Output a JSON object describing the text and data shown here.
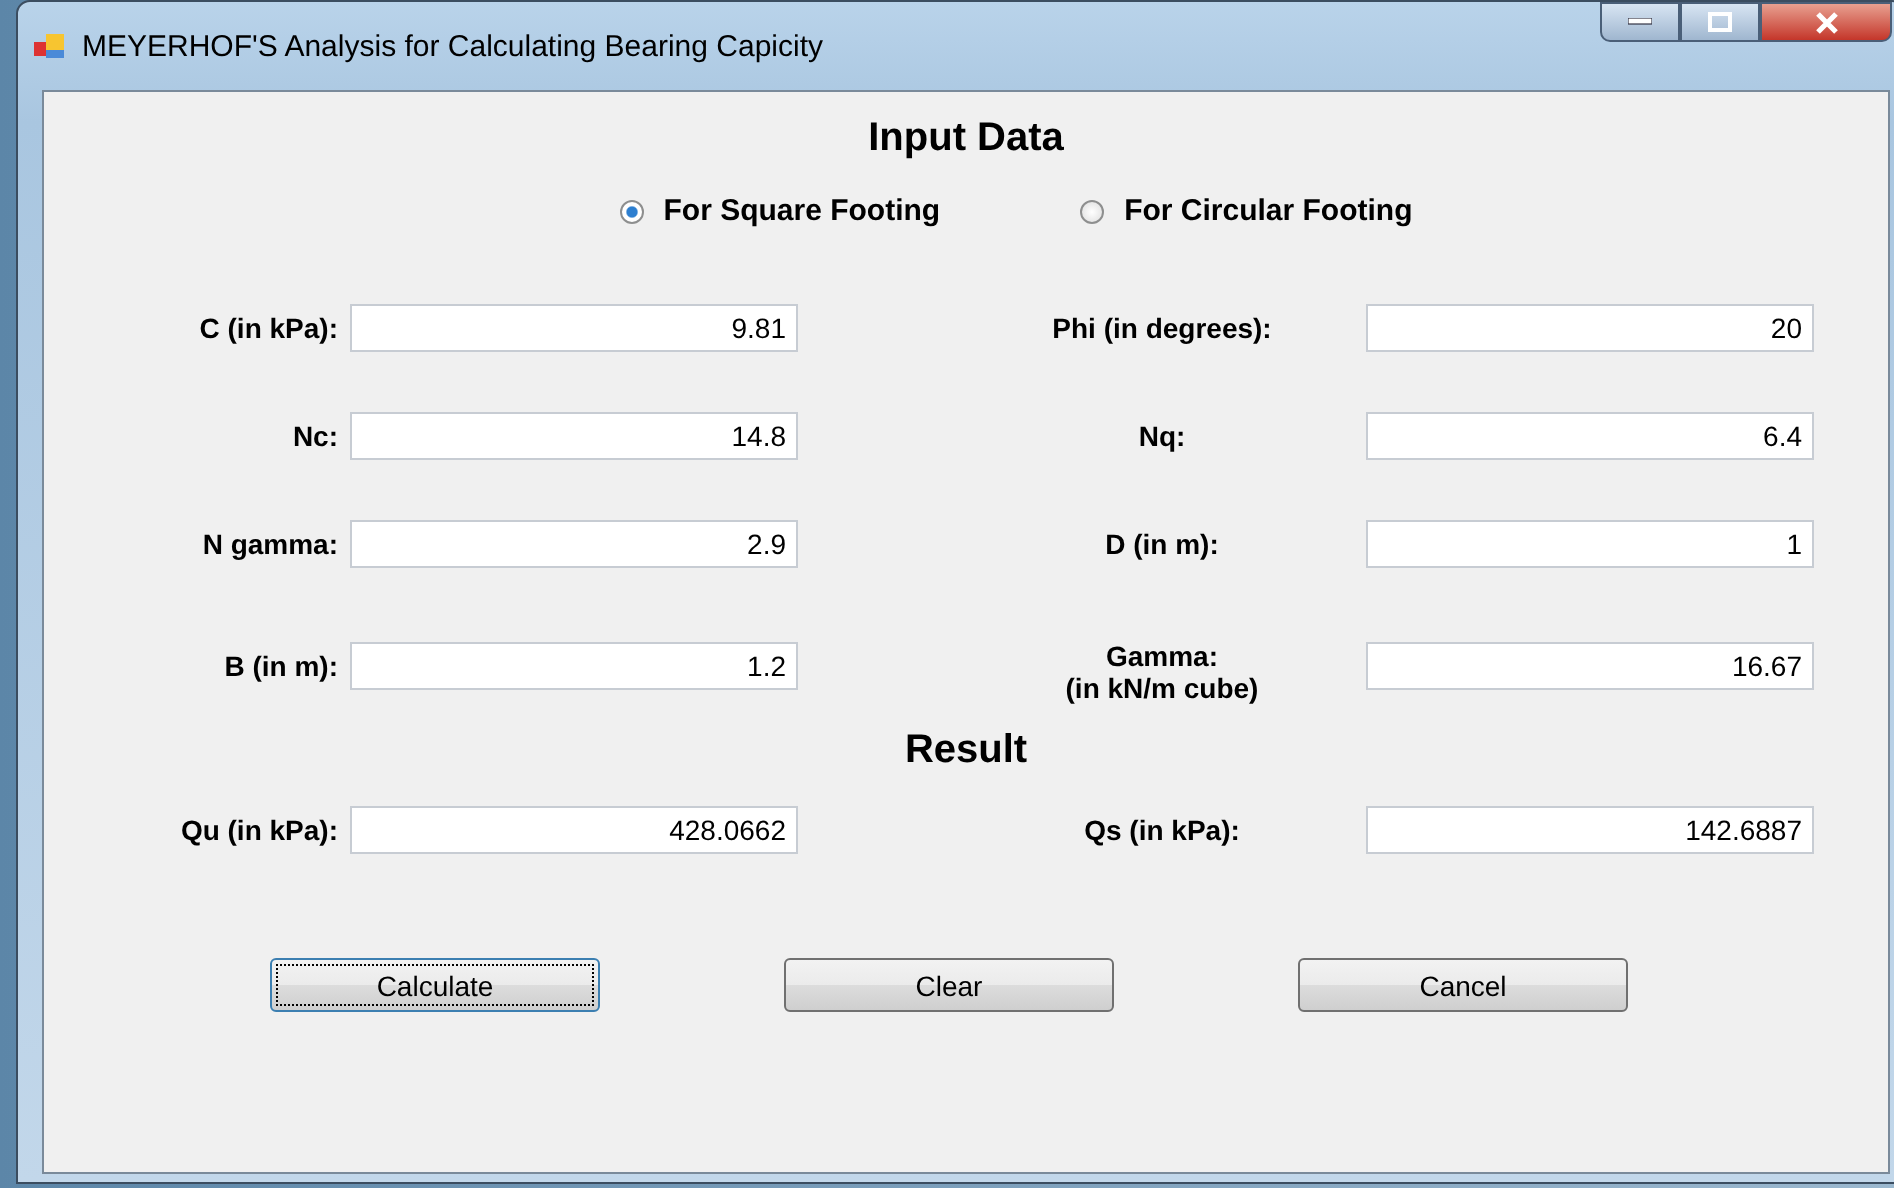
{
  "window": {
    "title": "MEYERHOF'S Analysis for Calculating Bearing Capicity"
  },
  "input_heading": "Input Data",
  "footing_options": [
    {
      "label": "For Square Footing",
      "selected": true
    },
    {
      "label": "For Circular Footing",
      "selected": false
    }
  ],
  "inputs": [
    {
      "label": "C (in kPa):",
      "value": "9.81"
    },
    {
      "label": "Phi (in degrees):",
      "value": "20"
    },
    {
      "label": "Nc:",
      "value": "14.8"
    },
    {
      "label": "Nq:",
      "value": "6.4"
    },
    {
      "label": "N gamma:",
      "value": "2.9"
    },
    {
      "label": "D (in m):",
      "value": "1"
    },
    {
      "label": "B (in m):",
      "value": "1.2"
    },
    {
      "label": "Gamma:\n(in kN/m cube)",
      "value": "16.67"
    }
  ],
  "result_heading": "Result",
  "results": [
    {
      "label": "Qu (in kPa):",
      "value": "428.0662"
    },
    {
      "label": "Qs (in kPa):",
      "value": "142.6887"
    }
  ],
  "buttons": [
    {
      "label": "Calculate",
      "focused": true
    },
    {
      "label": "Clear",
      "focused": false
    },
    {
      "label": "Cancel",
      "focused": false
    }
  ]
}
